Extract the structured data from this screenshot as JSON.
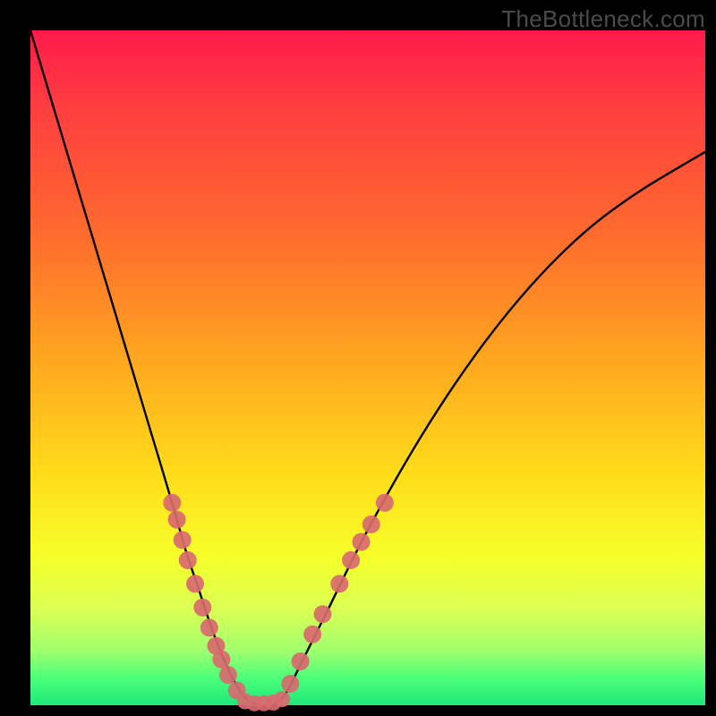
{
  "watermark": "TheBottleneck.com",
  "chart_data": {
    "type": "line",
    "title": "",
    "xlabel": "",
    "ylabel": "",
    "xlim": [
      0,
      100
    ],
    "ylim": [
      0,
      100
    ],
    "grid": false,
    "series": [
      {
        "name": "curve",
        "color": "#000000",
        "x": [
          0,
          3,
          6,
          9,
          12,
          15,
          18,
          21,
          23,
          25,
          27,
          29,
          30.5,
          32,
          34,
          36,
          38,
          40,
          44,
          50,
          58,
          66,
          74,
          82,
          90,
          100
        ],
        "y": [
          100,
          90,
          80,
          70,
          60,
          50,
          40,
          30,
          23,
          17,
          11,
          6,
          3,
          1,
          0,
          0,
          2,
          6,
          14,
          26,
          40,
          52,
          62,
          70,
          76,
          82
        ]
      }
    ],
    "markers": {
      "left_branch": {
        "color": "#d86a6f",
        "points": [
          {
            "x": 21.0,
            "y": 30.0
          },
          {
            "x": 21.7,
            "y": 27.5
          },
          {
            "x": 22.5,
            "y": 24.5
          },
          {
            "x": 23.3,
            "y": 21.5
          },
          {
            "x": 24.4,
            "y": 18.0
          },
          {
            "x": 25.5,
            "y": 14.5
          },
          {
            "x": 26.5,
            "y": 11.5
          },
          {
            "x": 27.5,
            "y": 8.8
          },
          {
            "x": 28.3,
            "y": 6.8
          },
          {
            "x": 29.3,
            "y": 4.5
          },
          {
            "x": 30.6,
            "y": 2.2
          }
        ]
      },
      "right_branch": {
        "color": "#d86a6f",
        "points": [
          {
            "x": 38.5,
            "y": 3.2
          },
          {
            "x": 40.0,
            "y": 6.5
          },
          {
            "x": 41.8,
            "y": 10.5
          },
          {
            "x": 43.3,
            "y": 13.5
          },
          {
            "x": 45.8,
            "y": 18.0
          },
          {
            "x": 47.5,
            "y": 21.5
          },
          {
            "x": 49.0,
            "y": 24.2
          },
          {
            "x": 50.5,
            "y": 26.8
          },
          {
            "x": 52.5,
            "y": 30.0
          }
        ]
      },
      "valley": {
        "color": "#d86a6f",
        "points": [
          {
            "x": 31.8,
            "y": 0.6
          },
          {
            "x": 33.2,
            "y": 0.3
          },
          {
            "x": 34.6,
            "y": 0.3
          },
          {
            "x": 36.0,
            "y": 0.4
          },
          {
            "x": 37.3,
            "y": 0.9
          }
        ]
      }
    },
    "background_gradient": {
      "top": "#ff1b4a",
      "bottom": "#1ee87a"
    }
  }
}
